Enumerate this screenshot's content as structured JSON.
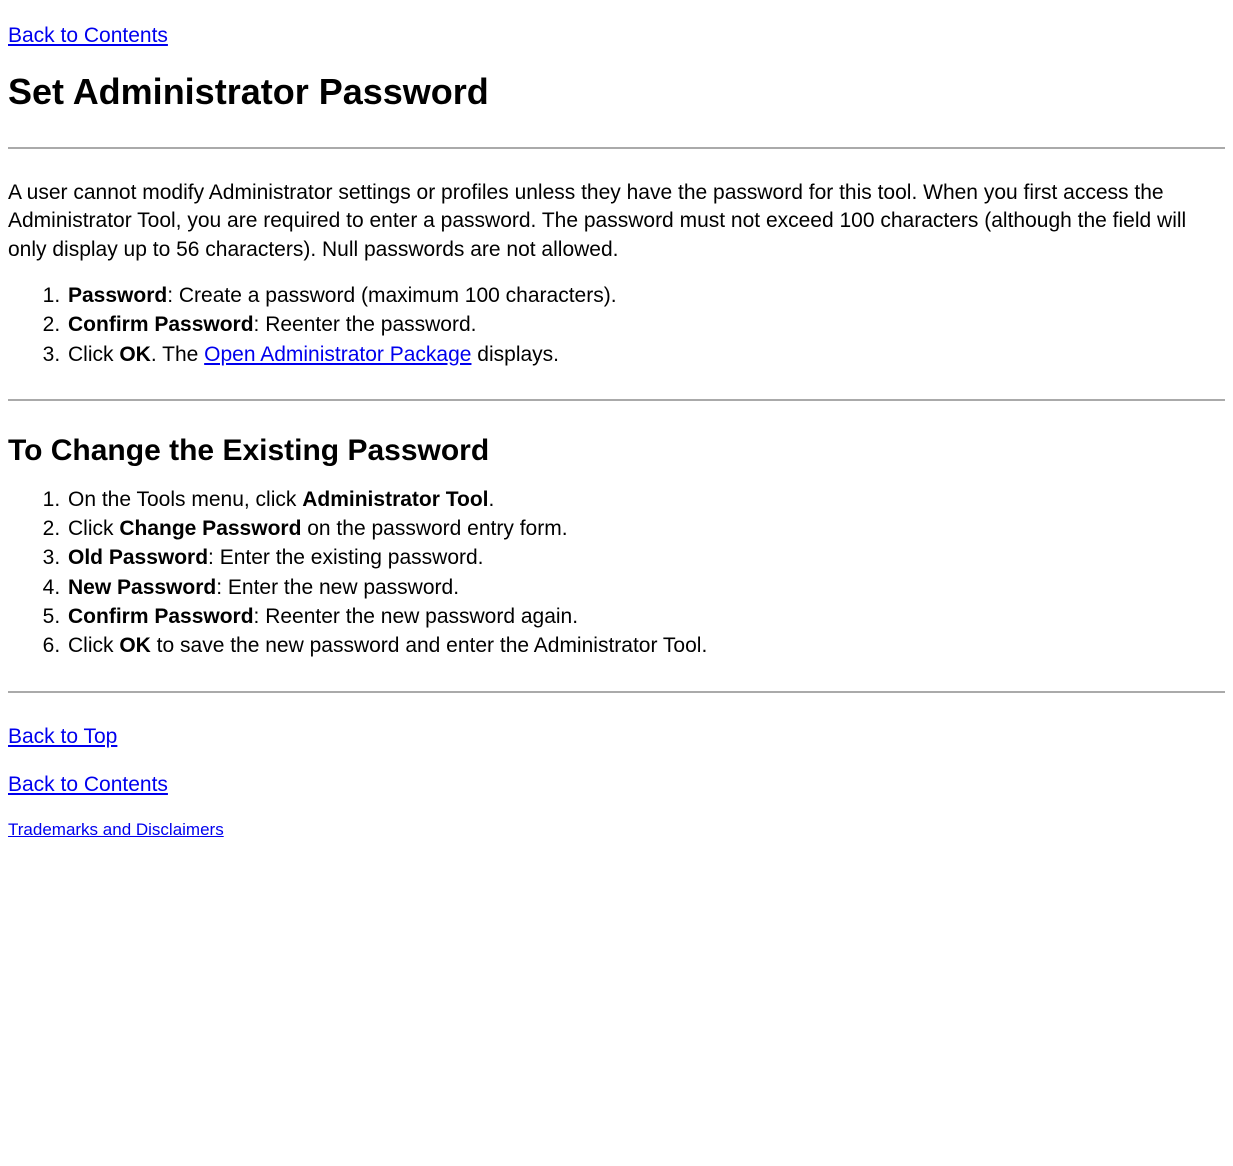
{
  "links": {
    "back_to_contents": "Back to Contents",
    "open_admin_package": "Open Administrator Package",
    "back_to_top": "Back to Top",
    "back_to_contents_bottom": "Back to Contents",
    "trademarks": "Trademarks and Disclaimers"
  },
  "heading1": "Set Administrator Password",
  "intro": "A user cannot modify Administrator settings or profiles unless they have the password for this tool. When you first access the Administrator Tool, you are required to enter a password. The password must not exceed 100 characters (although the field will only display up to 56 characters). Null passwords are not allowed.",
  "list1": {
    "item1": {
      "bold": "Password",
      "rest": ": Create a password (maximum 100 characters)."
    },
    "item2": {
      "bold": "Confirm Password",
      "rest": ": Reenter the password."
    },
    "item3": {
      "prefix": "Click ",
      "bold": "OK",
      "after_bold": ". The ",
      "after_link": " displays."
    }
  },
  "heading2": "To Change the Existing Password",
  "list2": {
    "item1": {
      "prefix": "On the Tools menu, click ",
      "bold": "Administrator Tool",
      "rest": "."
    },
    "item2": {
      "prefix": "Click ",
      "bold": "Change Password",
      "rest": " on the password entry form."
    },
    "item3": {
      "bold": "Old Password",
      "rest": ": Enter the existing password."
    },
    "item4": {
      "bold": "New Password",
      "rest": ": Enter the new password."
    },
    "item5": {
      "bold": "Confirm Password",
      "rest": ": Reenter the new password again."
    },
    "item6": {
      "prefix": "Click ",
      "bold": "OK",
      "rest": " to save the new password and enter the Administrator Tool."
    }
  }
}
